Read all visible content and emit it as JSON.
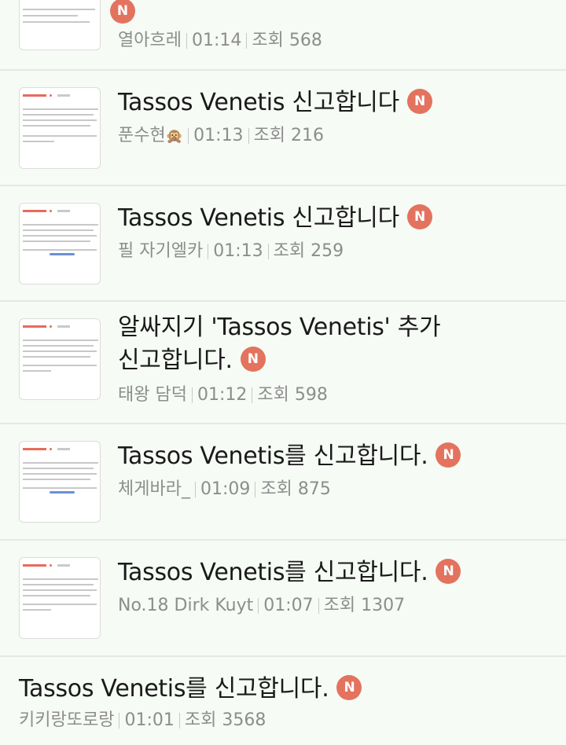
{
  "badge_letter": "N",
  "badge_color": "#e3735e",
  "posts": [
    {
      "title": "",
      "author": "열아흐레",
      "time": "01:14",
      "views_label": "조회",
      "views": "568"
    },
    {
      "title": "Tassos Venetis 신고합니다",
      "author": "푼수현",
      "author_emoji": "🙊",
      "time": "01:13",
      "views_label": "조회",
      "views": "216"
    },
    {
      "title": "Tassos Venetis 신고합니다",
      "author": "필 자기엘카",
      "time": "01:13",
      "views_label": "조회",
      "views": "259"
    },
    {
      "title_line1": "알싸지기 'Tassos Venetis' 추가",
      "title_line2": "신고합니다.",
      "author": "태왕 담덕",
      "time": "01:12",
      "views_label": "조회",
      "views": "598"
    },
    {
      "title": "Tassos Venetis를 신고합니다.",
      "author": "체게바라_",
      "time": "01:09",
      "views_label": "조회",
      "views": "875"
    },
    {
      "title": "Tassos Venetis를 신고합니다.",
      "author": "No.18 Dirk Kuyt",
      "time": "01:07",
      "views_label": "조회",
      "views": "1307"
    },
    {
      "title": "Tassos Venetis를 신고합니다.",
      "author": "키키랑또로랑",
      "time": "01:01",
      "views_label": "조회",
      "views": "3568"
    }
  ]
}
